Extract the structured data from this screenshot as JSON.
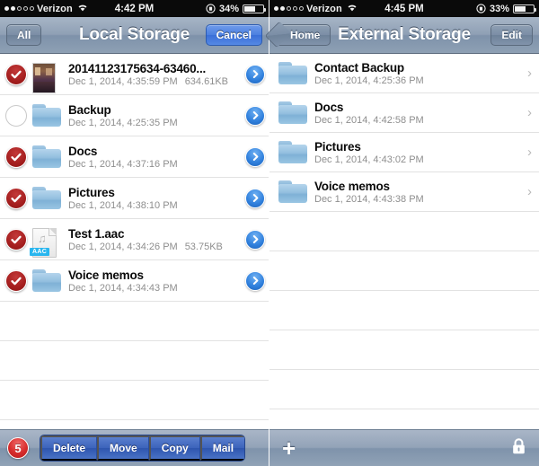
{
  "left_phone": {
    "status_bar": {
      "signal_dots_filled": 2,
      "signal_dots_total": 5,
      "carrier": "Verizon",
      "wifi_icon": "wifi-icon",
      "time": "4:42 PM",
      "rotation_lock_icon": "rotation-lock-icon",
      "battery_percent": "34%",
      "battery_level": 34
    },
    "nav": {
      "left_button": "All",
      "title": "Local Storage",
      "right_button": "Cancel"
    },
    "list": [
      {
        "selected": true,
        "icon": "photo-thumbnail",
        "title": "20141123175634-63460...",
        "date": "Dec 1, 2014, 4:35:59 PM",
        "size": "634.61KB",
        "accessory": "detail-disclosure-icon"
      },
      {
        "selected": false,
        "icon": "folder-icon",
        "title": "Backup",
        "date": "Dec 1, 2014, 4:25:35 PM",
        "size": "",
        "accessory": "detail-disclosure-icon"
      },
      {
        "selected": true,
        "icon": "folder-icon",
        "title": "Docs",
        "date": "Dec 1, 2014, 4:37:16 PM",
        "size": "",
        "accessory": "detail-disclosure-icon"
      },
      {
        "selected": true,
        "icon": "folder-icon",
        "title": "Pictures",
        "date": "Dec 1, 2014, 4:38:10 PM",
        "size": "",
        "accessory": "detail-disclosure-icon"
      },
      {
        "selected": true,
        "icon": "audio-file-icon",
        "icon_badge": "AAC",
        "title": "Test 1.aac",
        "date": "Dec 1, 2014, 4:34:26 PM",
        "size": "53.75KB",
        "accessory": "detail-disclosure-icon"
      },
      {
        "selected": true,
        "icon": "folder-icon",
        "title": "Voice memos",
        "date": "Dec 1, 2014, 4:34:43 PM",
        "size": "",
        "accessory": "detail-disclosure-icon"
      }
    ],
    "empty_rows": 4,
    "toolbar": {
      "selection_count": "5",
      "actions": [
        "Delete",
        "Move",
        "Copy",
        "Mail"
      ]
    }
  },
  "right_phone": {
    "status_bar": {
      "signal_dots_filled": 2,
      "signal_dots_total": 5,
      "carrier": "Verizon",
      "wifi_icon": "wifi-icon",
      "time": "4:45 PM",
      "rotation_lock_icon": "rotation-lock-icon",
      "battery_percent": "33%",
      "battery_level": 33
    },
    "nav": {
      "left_button": "Home",
      "title": "External Storage",
      "right_button": "Edit"
    },
    "list": [
      {
        "icon": "folder-icon",
        "title": "Contact Backup",
        "date": "Dec 1, 2014, 4:25:36 PM",
        "accessory": "chevron-right-icon"
      },
      {
        "icon": "folder-icon",
        "title": "Docs",
        "date": "Dec 1, 2014, 4:42:58 PM",
        "accessory": "chevron-right-icon"
      },
      {
        "icon": "folder-icon",
        "title": "Pictures",
        "date": "Dec 1, 2014, 4:43:02 PM",
        "accessory": "chevron-right-icon"
      },
      {
        "icon": "folder-icon",
        "title": "Voice memos",
        "date": "Dec 1, 2014, 4:43:38 PM",
        "accessory": "chevron-right-icon"
      }
    ],
    "empty_rows": 6,
    "toolbar": {
      "add_icon": "plus-icon",
      "add_label": "+",
      "lock_icon": "lock-icon"
    }
  },
  "colors": {
    "nav_bar": "#8fa0b5",
    "accent_blue": "#2f7fdc",
    "selected_red": "#a51f1f",
    "badge_red": "#d62b2b",
    "toolbar_button_blue": "#3c63bb",
    "folder_blue": "#93bfdf",
    "aac_badge": "#29b6ef"
  }
}
